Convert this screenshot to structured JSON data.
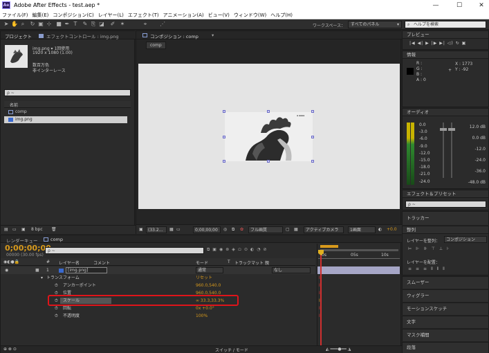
{
  "window": {
    "title": "Adobe After Effects - test.aep *",
    "logo": "Ae",
    "minimize": "—",
    "maximize": "☐",
    "close": "✕"
  },
  "menu": [
    "ファイル(F)",
    "編集(E)",
    "コンポジション(C)",
    "レイヤー(L)",
    "エフェクト(T)",
    "アニメーション(A)",
    "ビュー(V)",
    "ウィンドウ(W)",
    "ヘルプ(H)"
  ],
  "toolbar": {
    "workspace_label": "ワークスペース：",
    "workspace_value": "すべてのパネル",
    "help_placeholder": "ヘルプを検索"
  },
  "project": {
    "tab_project": "プロジェクト",
    "tab_effects": "エフェクトコントロール : img.png",
    "asset_name": "img.png ▾  1回使用",
    "asset_dims": "1920 x 1080 (1.00)",
    "asset_color": "数百万色",
    "asset_interlace": "非インターレース",
    "search": "ρ ~",
    "col_name": "名前",
    "items": [
      {
        "name": "comp",
        "icon": "comp-icon"
      },
      {
        "name": "img.png",
        "icon": "image-icon"
      }
    ],
    "bpc": "8 bpc"
  },
  "comp": {
    "tab": "コンポジション : comp",
    "subtab": "comp",
    "bottom": {
      "zoom": "(33.2...",
      "time": "0;00;00;00",
      "res": "フル画質",
      "camera": "アクティブカメラ",
      "view": "1画面",
      "offset": "+0.0"
    }
  },
  "preview": {
    "title": "プレビュー",
    "controls": [
      "|◀",
      "◀|",
      "▶",
      "|▶",
      "▶|",
      "◁)",
      "↻",
      "▣"
    ]
  },
  "info": {
    "title": "情報",
    "r": "R :",
    "g": "G :",
    "b": "B :",
    "a": "A : 0",
    "x": "X : 1773",
    "y": "Y : -92"
  },
  "audio": {
    "title": "オーディオ",
    "left": [
      "0.0",
      "-3.0",
      "-6.0",
      "-9.0",
      "-12.0",
      "-15.0",
      "-18.0",
      "-21.0",
      "-24.0"
    ],
    "right": [
      "12.0 dB",
      "0.0 dB",
      "-12.0",
      "-24.0",
      "-36.0",
      "-48.0 dB"
    ]
  },
  "right_panels": {
    "effects_presets": "エフェクト＆プリセット",
    "effects_search": "ρ ~",
    "tracker": "トラッカー",
    "align": "整列",
    "align_to_label": "レイヤーを整列：",
    "align_to_value": "コンポジション",
    "distribute": "レイヤーを配置：",
    "smoother": "スムーザー",
    "wiggler": "ウィグラー",
    "motion_sketch": "モーションスケッチ",
    "text": "文字",
    "mask_interp": "マスク補間",
    "paragraph": "段落"
  },
  "timeline": {
    "tab_render": "レンダーキュー",
    "tab_comp": "comp",
    "timecode": "0;00;00;00",
    "fps": "00000 (30.00 fps)",
    "search": "ρ ~",
    "headers": {
      "num": "#",
      "layer": "レイヤー名",
      "comment": "コメント",
      "mode": "モード",
      "t": "T",
      "trkmat": "トラックマット",
      "parent": "親"
    },
    "layer": {
      "num": "1",
      "name": "[img.png]",
      "mode": "通常",
      "parent": "なし"
    },
    "transform": {
      "label": "トランスフォーム",
      "reset": "リセット"
    },
    "props": [
      {
        "name": "アンカーポイント",
        "value": "960.0,540.0"
      },
      {
        "name": "位置",
        "value": "960.0,540.0"
      },
      {
        "name": "スケール",
        "value": "∞ 33.3,33.3%"
      },
      {
        "name": "回転",
        "value": "0x +0.0°"
      },
      {
        "name": "不透明度",
        "value": "100%"
      }
    ],
    "ruler": [
      "0s",
      "05s",
      "10s"
    ],
    "switch_mode": "スイッチ / モード"
  }
}
